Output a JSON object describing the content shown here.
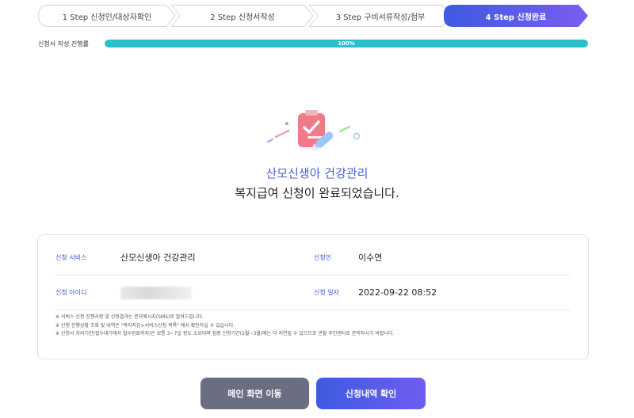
{
  "steps": [
    {
      "label": "1 Step 신청인/대상자확인",
      "active": false
    },
    {
      "label": "2 Step 신청서작성",
      "active": false
    },
    {
      "label": "3 Step 구비서류작성/첨부",
      "active": false
    },
    {
      "label": "4 Step 신청완료",
      "active": true
    }
  ],
  "progress": {
    "label": "신청서 작성 진행률",
    "value": 100,
    "text": "100%"
  },
  "result": {
    "service_title": "산모신생아 건강관리",
    "message": "복지급여 신청이 완료되었습니다."
  },
  "details": {
    "service_label": "신청 서비스",
    "service_value": "산모신생아 건강관리",
    "applicant_label": "신청인",
    "applicant_value": "이수연",
    "id_label": "신청 아이디",
    "date_label": "신청 일자",
    "date_value": "2022-09-22 08:52"
  },
  "notes": [
    "※ 서비스 신청 진행사항 및 신청결과는 문자메시지(SMS)로 알려드립니다.",
    "※ 신청 진행상황 조회 및 내역은 \"복지지갑>서비스신청 목록\" 에서 확인하실 수 있습니다.",
    "※ 신청서 처리기한(접수대기에서 접수완료까지)은 보통 3~7일 정도 소요되며 집중 신청기간(2월~3월)에는 더 지연될 수 있으므로 관할 주민센터로 문의하시기 바랍니다."
  ],
  "buttons": {
    "main_label": "메인 화면 이동",
    "history_label": "신청내역 확인"
  },
  "colors": {
    "accent": "#4a5fd6",
    "active_step_start": "#3e5be0",
    "active_step_end": "#7a5cf0",
    "progress_fill": "#2bbfcc",
    "main_button": "#6b6e80"
  },
  "icons": {
    "illustration": "document-checked-pen-icon"
  }
}
